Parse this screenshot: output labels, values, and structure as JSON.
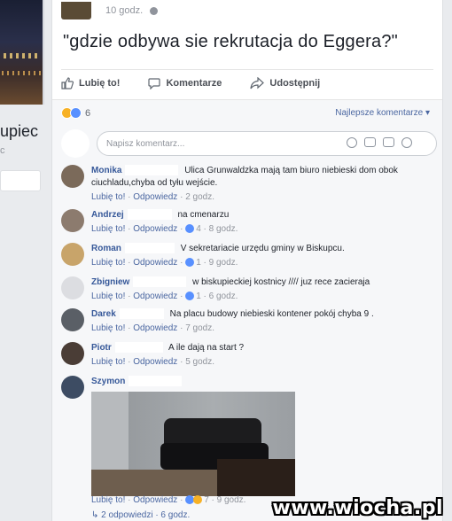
{
  "left": {
    "name": "upiec",
    "sub": "c"
  },
  "post": {
    "time": "10 godz.",
    "text": "\"gdzie odbywa sie rekrutacja do Eggera?\"",
    "actions": {
      "like": "Lubię to!",
      "comment": "Komentarze",
      "share": "Udostępnij"
    }
  },
  "reactions": {
    "count": "6",
    "sort": "Najlepsze komentarze ▾"
  },
  "composer": {
    "placeholder": "Napisz komentarz..."
  },
  "comments": [
    {
      "name": "Monika",
      "text": "Ulica Grunwaldzka mają tam biuro niebieski dom obok ciuchladu,chyba od tyłu wejście.",
      "like": "Lubię to!",
      "reply": "Odpowiedz",
      "likes": "",
      "time": "2 godz."
    },
    {
      "name": "Andrzej",
      "text": "na cmenarzu",
      "like": "Lubię to!",
      "reply": "Odpowiedz",
      "likes": "4",
      "time": "8 godz."
    },
    {
      "name": "Roman",
      "text": "V sekretariacie urzędu gminy w Biskupcu.",
      "like": "Lubię to!",
      "reply": "Odpowiedz",
      "likes": "1",
      "time": "9 godz."
    },
    {
      "name": "Zbigniew",
      "text": "w biskupieckiej kostnicy //// juz rece zacieraja",
      "like": "Lubię to!",
      "reply": "Odpowiedz",
      "likes": "1",
      "time": "6 godz."
    },
    {
      "name": "Darek",
      "text": "Na placu budowy niebieski kontener pokój chyba 9 .",
      "like": "Lubię to!",
      "reply": "Odpowiedz",
      "likes": "",
      "time": "7 godz."
    },
    {
      "name": "Piotr",
      "text": "A ile dają na start ?",
      "like": "Lubię to!",
      "reply": "Odpowiedz",
      "likes": "",
      "time": "5 godz."
    },
    {
      "name": "Szymon",
      "text": "",
      "like": "Lubię to!",
      "reply": "Odpowiedz",
      "likes": "7",
      "time": "9 godz."
    }
  ],
  "replies": "2 odpowiedzi · 6 godz.",
  "watermark": "www.wiocha.pl",
  "colors": {
    "link": "#365899",
    "fb_bg": "#e9ebee",
    "like_blue": "#5890ff"
  }
}
